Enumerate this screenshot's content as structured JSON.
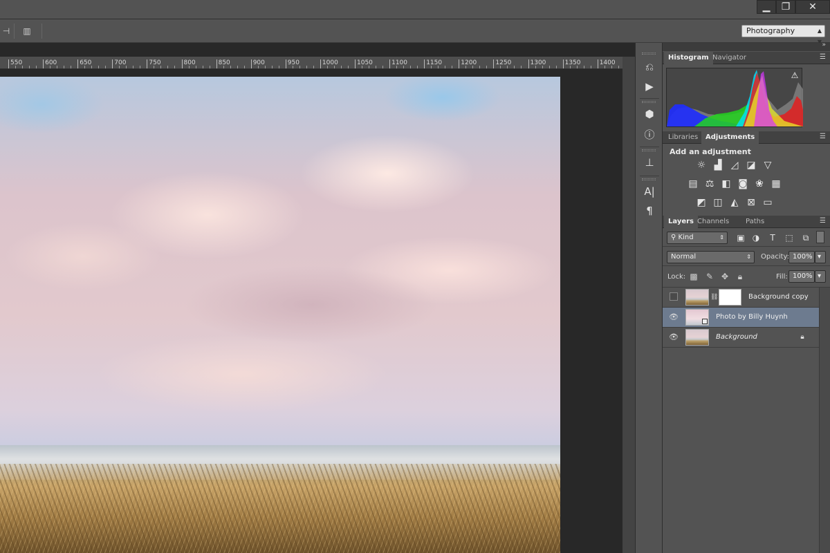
{
  "window": {
    "minimize": "▁",
    "restore": "❐",
    "close": "✕"
  },
  "options_bar": {
    "workspace": "Photography"
  },
  "ruler": {
    "labels": [
      "550",
      "600",
      "650",
      "700",
      "750",
      "800",
      "850",
      "900",
      "950",
      "1000",
      "1050",
      "1100",
      "1150",
      "1200",
      "1250",
      "1300",
      "1350",
      "1400"
    ]
  },
  "panels": {
    "histogram_tabs": [
      "Histogram",
      "Navigator"
    ],
    "adjustments_tabs": [
      "Libraries",
      "Adjustments"
    ],
    "adjustments_title": "Add an adjustment",
    "layers_tabs": [
      "Layers",
      "Channels",
      "Paths"
    ]
  },
  "layers": {
    "kind_label": "Kind",
    "blend_mode": "Normal",
    "opacity_label": "Opacity:",
    "opacity_value": "100%",
    "lock_label": "Lock:",
    "fill_label": "Fill:",
    "fill_value": "100%",
    "items": [
      {
        "name": "Background copy",
        "visible": false,
        "selected": false
      },
      {
        "name": "Photo by Billy Huynh",
        "visible": true,
        "selected": true
      },
      {
        "name": "Background",
        "visible": true,
        "selected": false,
        "locked": true
      }
    ]
  }
}
